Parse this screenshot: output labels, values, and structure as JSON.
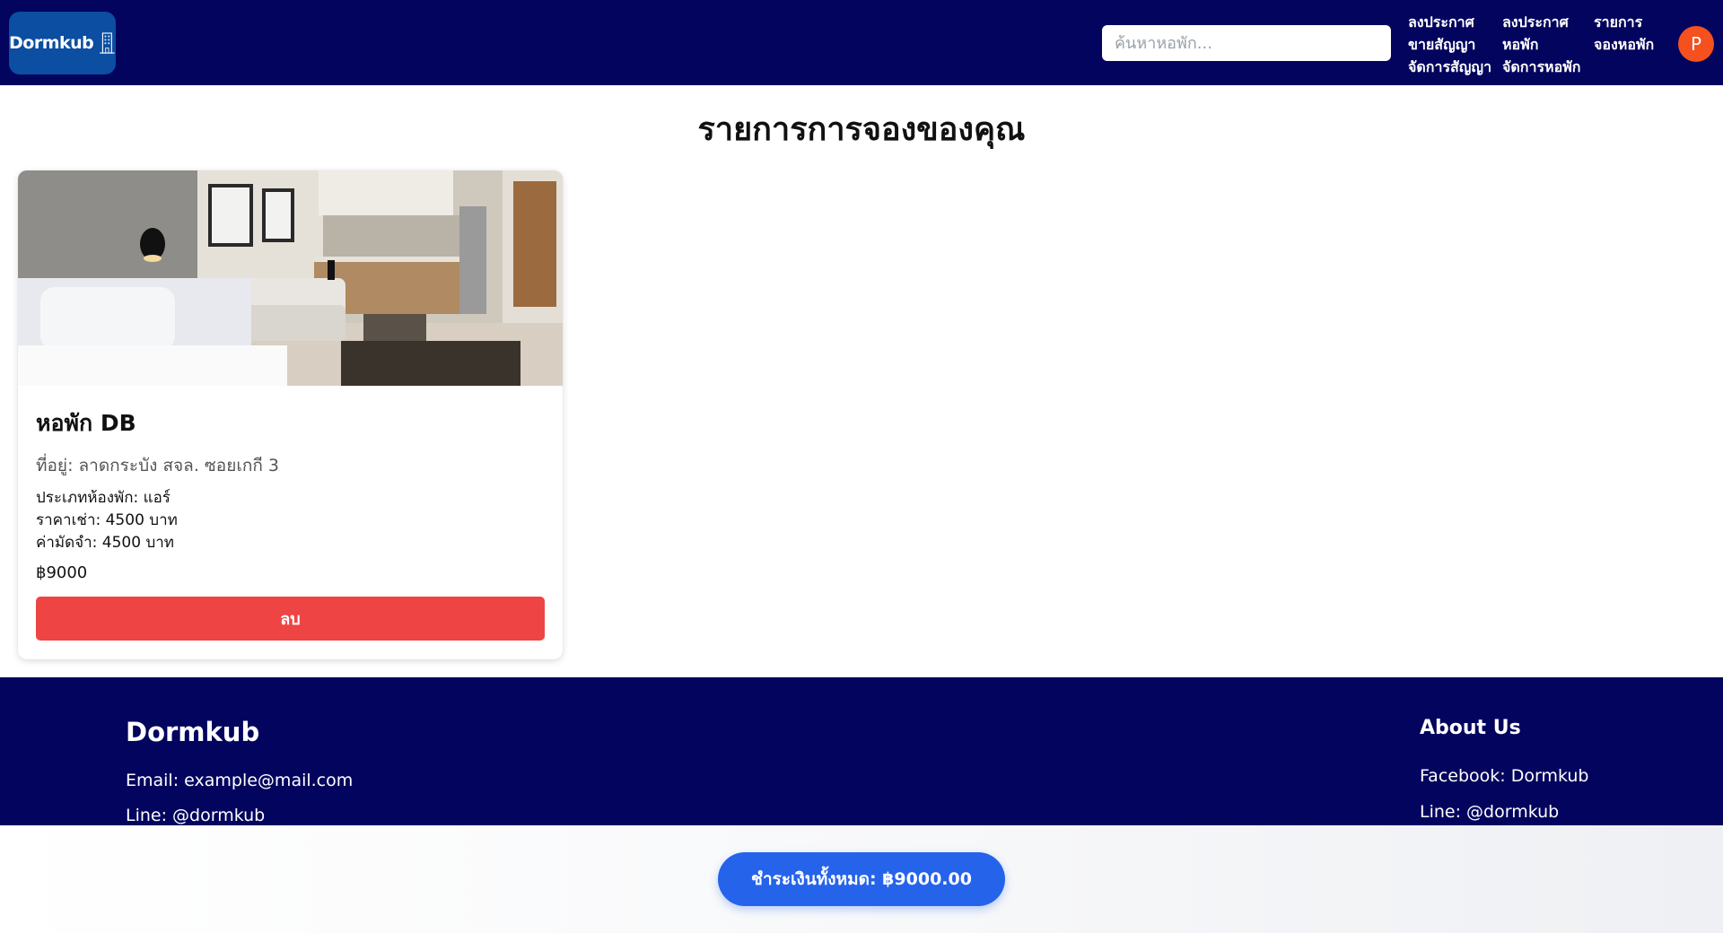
{
  "header": {
    "logo_text": "Dormkub",
    "search_placeholder": "ค้นหาหอพัก...",
    "nav": [
      {
        "label": "ลงประกาศ\nขายสัญญา\nจัดการสัญญา"
      },
      {
        "label": "ลงประกาศ\nหอพัก\nจัดการหอพัก"
      },
      {
        "label": "รายการ\nจองหอพัก"
      }
    ],
    "avatar_initial": "P"
  },
  "main": {
    "title": "รายการการจองของคุณ",
    "bookings": [
      {
        "name": "หอพัก DB",
        "address": "ที่อยู่: ลาดกระบัง สจล. ซอยเกกี 3",
        "room_type": "ประเภทห้องพัก: แอร์",
        "rent": "ราคาเช่า: 4500 บาท",
        "deposit": "ค่ามัดจำ: 4500 บาท",
        "total": "฿9000",
        "delete_label": "ลบ"
      }
    ]
  },
  "footer": {
    "brand": "Dormkub",
    "email": "Email: example@mail.com",
    "line": "Line: @dormkub",
    "about_title": "About Us",
    "facebook": "Facebook: Dormkub",
    "about_line": "Line: @dormkub"
  },
  "paybar": {
    "button_label": "ชำระเงินทั้งหมด: ฿9000.00"
  },
  "colors": {
    "header_bg": "#03045e",
    "logo_bg": "#0b4ea2",
    "delete": "#ef4444",
    "pay": "#2563eb",
    "avatar": "#f4511e"
  }
}
